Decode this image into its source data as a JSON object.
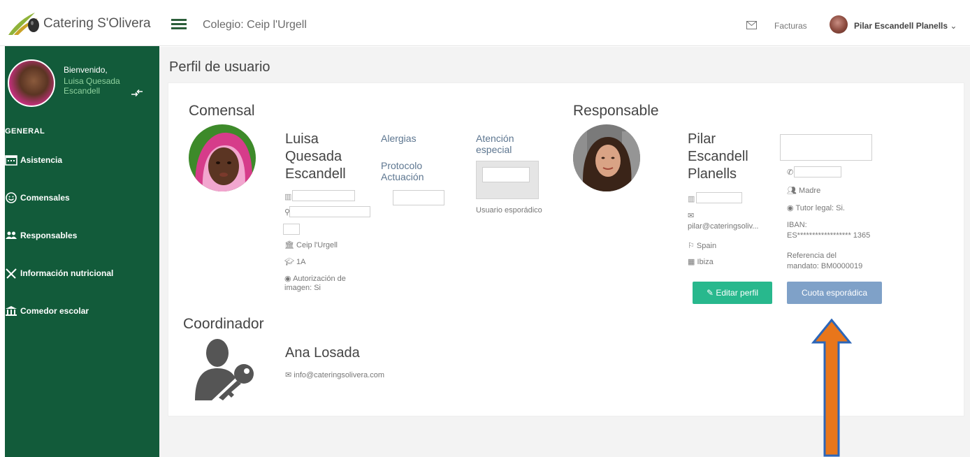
{
  "header": {
    "logo_text": "Catering S'Olivera",
    "school_title": "Colegio: Ceip l'Urgell",
    "facturas_label": "Facturas",
    "user_name": "Pilar Escandell Planells"
  },
  "sidebar": {
    "welcome": "Bienvenido,",
    "name_line1": "Luisa Quesada",
    "name_line2": "Escandell",
    "section": "GENERAL",
    "items": [
      {
        "label": "Asistencia",
        "icon": "calendar-icon"
      },
      {
        "label": "Comensales",
        "icon": "smile-icon"
      },
      {
        "label": "Responsables",
        "icon": "users-icon"
      },
      {
        "label": "Información nutricional",
        "icon": "cutlery-icon"
      },
      {
        "label": "Comedor escolar",
        "icon": "bank-icon"
      }
    ]
  },
  "main": {
    "page_title": "Perfil de usuario",
    "comensal": {
      "section_title": "Comensal",
      "name_line1": "Luisa",
      "name_line2": "Quesada",
      "name_line3": "Escandell",
      "alergias_label": "Alergias",
      "protocolo_label": "Protocolo Actuación",
      "atencion_label": "Atención especial",
      "usuario_esporadico": "Usuario esporádico",
      "school": "Ceip l'Urgell",
      "class": "1A",
      "autorizacion_line1": "Autorización de",
      "autorizacion_line2": "imagen: Si"
    },
    "responsable": {
      "section_title": "Responsable",
      "name_line1": "Pilar",
      "name_line2": "Escandell",
      "name_line3": "Planells",
      "email": "pilar@cateringsoliv...",
      "country": "Spain",
      "city": "Ibiza",
      "relation": "Madre",
      "tutor": "Tutor legal: Si.",
      "iban_label": "IBAN:",
      "iban_value": "ES****************** 1365",
      "ref_line1": "Referencia del",
      "ref_line2": "mandato: BM0000019",
      "edit_button": "Editar perfil",
      "cuota_button": "Cuota esporádica"
    },
    "coordinador": {
      "section_title": "Coordinador",
      "name": "Ana Losada",
      "email": "info@cateringsolivera.com"
    }
  },
  "colors": {
    "sidebar_bg": "#125b3a",
    "edit_button": "#28b88d",
    "cuota_button": "#7fa1c8",
    "arrow_fill": "#e8761b",
    "arrow_outline": "#2c66b8"
  }
}
